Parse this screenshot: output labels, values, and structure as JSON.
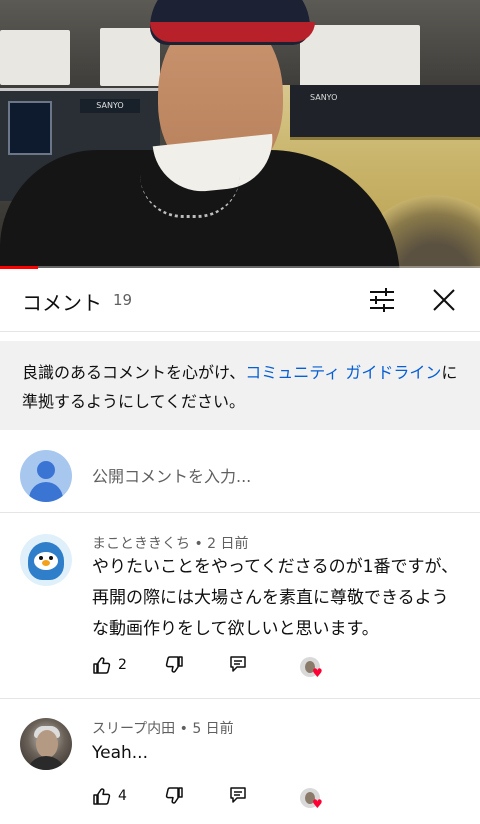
{
  "video": {
    "progress_fraction": 0.08,
    "brand_left": "SANYO",
    "brand_right": "SANYO"
  },
  "sheet": {
    "title": "コメント",
    "count": "19",
    "sort_icon": "tune-icon",
    "close_icon": "close-icon"
  },
  "guideline": {
    "before": "良識のあるコメントを心がけ、",
    "link": "コミュニティ ガイドライン",
    "after": "に準拠するようにしてください。"
  },
  "add_comment": {
    "placeholder": "公開コメントを入力..."
  },
  "comments": [
    {
      "meta": "まことききくち • 2 日前",
      "text": "やりたいことをやってくださるのが1番ですが、再開の際には大場さんを素直に尊敬できるような動画作りをして欲しいと思います。",
      "likes": "2"
    },
    {
      "meta": "スリープ内田 • 5 日前",
      "text": "Yeah...",
      "likes": "4"
    }
  ],
  "colors": {
    "accent_link": "#065fd4",
    "progress": "#ff0000",
    "heart": "#ff0033"
  }
}
